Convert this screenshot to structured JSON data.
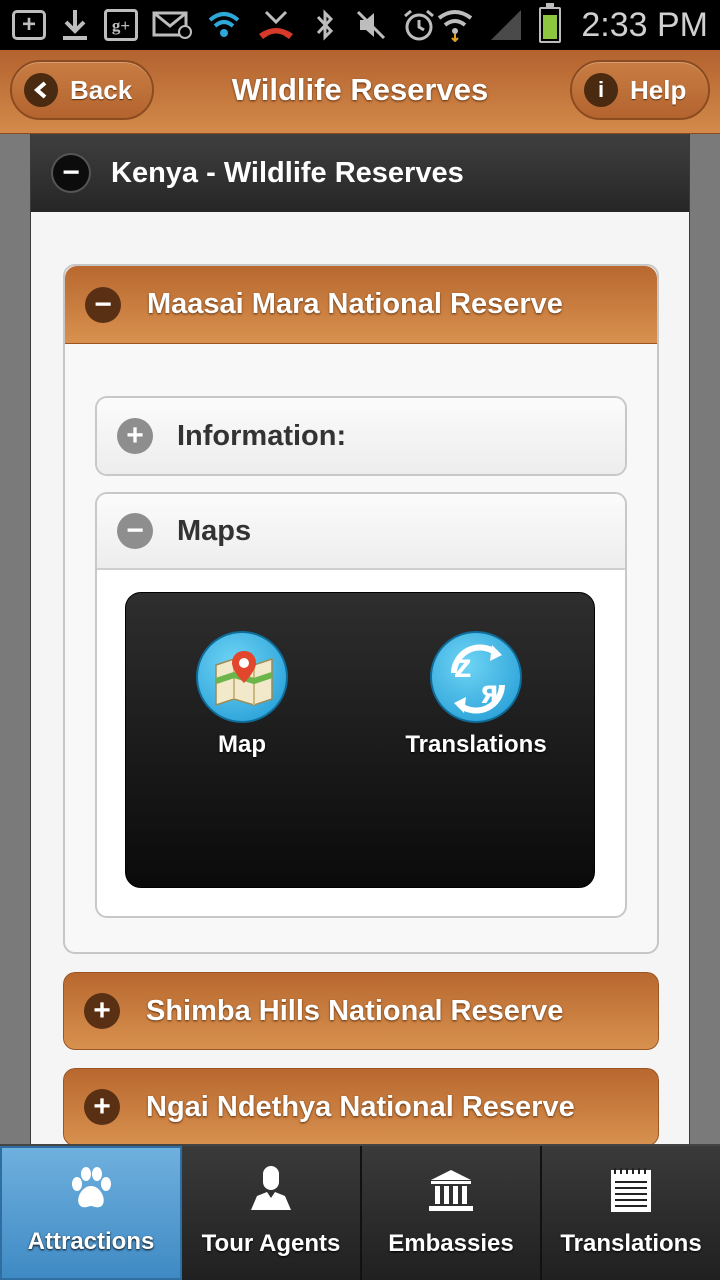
{
  "status_bar": {
    "time": "2:33 PM",
    "battery_level": 0.85,
    "icons": [
      "add-box-icon",
      "download-icon",
      "google-plus-icon",
      "email-icon",
      "wifi-calling-icon",
      "missed-call-icon",
      "bluetooth-icon",
      "mute-icon",
      "alarm-icon",
      "wifi-icon",
      "signal-icon",
      "battery-icon"
    ],
    "gplus_text": "g+"
  },
  "header": {
    "title": "Wildlife Reserves",
    "back_label": "Back",
    "help_label": "Help",
    "help_icon_text": "i"
  },
  "outer": {
    "title": "Kenya - Wildlife Reserves",
    "state_icon": "−"
  },
  "reserves": [
    {
      "name": "Maasai Mara National Reserve",
      "state_icon": "−"
    },
    {
      "name": "Shimba Hills National Reserve",
      "state_icon": "+"
    },
    {
      "name": "Ngai Ndethya National Reserve",
      "state_icon": "+"
    }
  ],
  "sections": {
    "information": {
      "label": "Information:",
      "state_icon": "+"
    },
    "maps": {
      "label": "Maps",
      "state_icon": "−"
    }
  },
  "launcher": {
    "map_label": "Map",
    "translations_label": "Translations"
  },
  "tabs": [
    {
      "label": "Attractions",
      "icon": "paw-icon",
      "active": true
    },
    {
      "label": "Tour Agents",
      "icon": "person-icon",
      "active": false
    },
    {
      "label": "Embassies",
      "icon": "building-icon",
      "active": false
    },
    {
      "label": "Translations",
      "icon": "notepad-icon",
      "active": false
    }
  ],
  "colors": {
    "header_brown": "#c4763c",
    "active_tab_blue": "#4f97cc",
    "battery_green": "#8dc63f"
  }
}
